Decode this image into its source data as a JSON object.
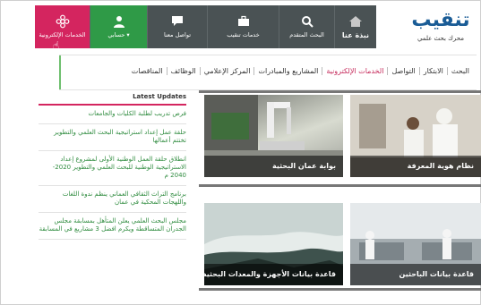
{
  "logo": {
    "mark_main": "تنقيب",
    "tagline": "محرك بحث علمي"
  },
  "topnav": {
    "items": [
      {
        "label": "الخدمات الإلكترونية",
        "icon": "flower-icon",
        "color": "#d4255f"
      },
      {
        "label": "حسابي ▾",
        "icon": "user-icon",
        "color": "#2f9a47"
      },
      {
        "label": "تواصل معنا",
        "icon": "chat-icon"
      },
      {
        "label": "خدمات تنقيب",
        "icon": "briefcase-icon"
      },
      {
        "label": "البحث المتقدم",
        "icon": "search-icon"
      },
      {
        "label": "نبذة عنا",
        "icon": "home-icon"
      }
    ]
  },
  "mainmenu": {
    "items": [
      "البحث",
      "الابتكار",
      "التواصل",
      "الخدمات الإلكترونية",
      "المشاريع والمبادرات",
      "المركز الإعلامي",
      "الوظائف",
      "المناقصات"
    ],
    "active": "الخدمات الإلكترونية",
    "accent_color": "#c62b5c"
  },
  "updates": {
    "header": "Latest Updates",
    "items": [
      "فرص تدريب لطلبة الكليات والجامعات",
      "حلقة عمل إعداد استراتيجية البحث العلمي والتطوير تختتم أعمالها",
      "انطلاق حلقة العمل الوطنية الأولى لمشروع إعداد الاستراتيجية الوطنية للبحث العلمي والتطوير 2020- 2040 م",
      "برنامج التراث الثقافي العماني ينظم ندوة اللغات واللهجات المحكية في عمان",
      "مجلس البحث العلمي يعلن المتأهل بمسابقة مجلس الجدران المتساقطة ويكرم افضل 3 مشاريع في المسابقة"
    ]
  },
  "tiles": [
    {
      "caption": "بوابة عمان البحثية"
    },
    {
      "caption": "نظام هوية المعرفة"
    },
    {
      "caption": "قاعدة بيانات الأجهزة والمعدات البحثية"
    },
    {
      "caption": "قاعدة بيانات الباحثين"
    }
  ]
}
